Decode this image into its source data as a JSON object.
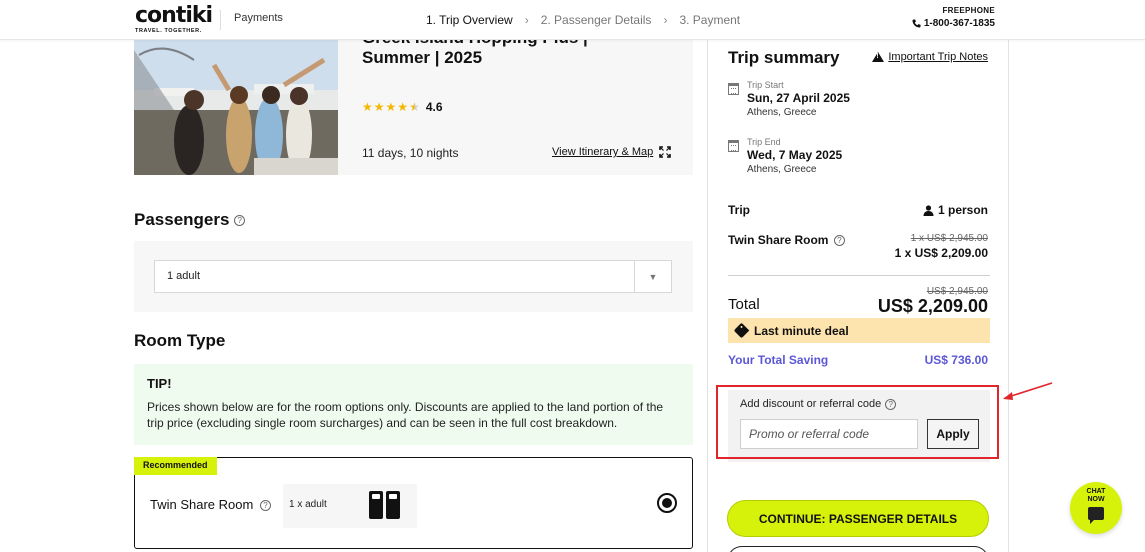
{
  "header": {
    "logo_word": "contiki",
    "logo_tagline": "TRAVEL. TOGETHER.",
    "section": "Payments",
    "steps": [
      {
        "label": "1. Trip Overview"
      },
      {
        "label": "2. Passenger Details"
      },
      {
        "label": "3. Payment"
      }
    ],
    "freephone_label": "FREEPHONE",
    "freephone_number": "1-800-367-1835"
  },
  "trip": {
    "title_line1": "Greek Island Hopping Plus |",
    "title_line2": "Summer | 2025",
    "rating": "4.6",
    "stars": 4.5,
    "duration": "11 days, 10 nights",
    "itinerary_link": "View Itinerary & Map"
  },
  "passengers": {
    "title": "Passengers",
    "selected": "1 adult"
  },
  "room_type": {
    "title": "Room Type",
    "tip_title": "TIP!",
    "tip_text": "Prices shown below are for the room options only. Discounts are applied to the land portion of the trip price (excluding single room surcharges) and can be seen in the full cost breakdown.",
    "option": {
      "badge": "Recommended",
      "name": "Twin Share Room",
      "occupancy": "1 x adult"
    }
  },
  "summary": {
    "title": "Trip summary",
    "notes_link": "Important Trip Notes",
    "start": {
      "label": "Trip Start",
      "date": "Sun, 27 April 2025",
      "location": "Athens, Greece"
    },
    "end": {
      "label": "Trip End",
      "date": "Wed, 7 May 2025",
      "location": "Athens, Greece"
    },
    "trip_label": "Trip",
    "persons": "1 person",
    "room_label": "Twin Share Room",
    "room_old_price": "1 x US$ 2,945.00",
    "room_new_price": "1 x US$ 2,209.00",
    "total_label": "Total",
    "total_old": "US$ 2,945.00",
    "total_value": "US$ 2,209.00",
    "deal_label": "Last minute deal",
    "saving_label": "Your Total Saving",
    "saving_value": "US$ 736.00",
    "promo_label": "Add discount or referral code",
    "promo_placeholder": "Promo or referral code",
    "apply_label": "Apply",
    "continue_label": "CONTINUE: PASSENGER DETAILS"
  },
  "chat": {
    "line1": "CHAT",
    "line2": "NOW"
  },
  "colors": {
    "accent": "#d7f20a",
    "saving": "#5b57d6",
    "deal_bg": "#fde3ad",
    "tip_bg": "#effbef",
    "highlight": "#e0262b"
  }
}
